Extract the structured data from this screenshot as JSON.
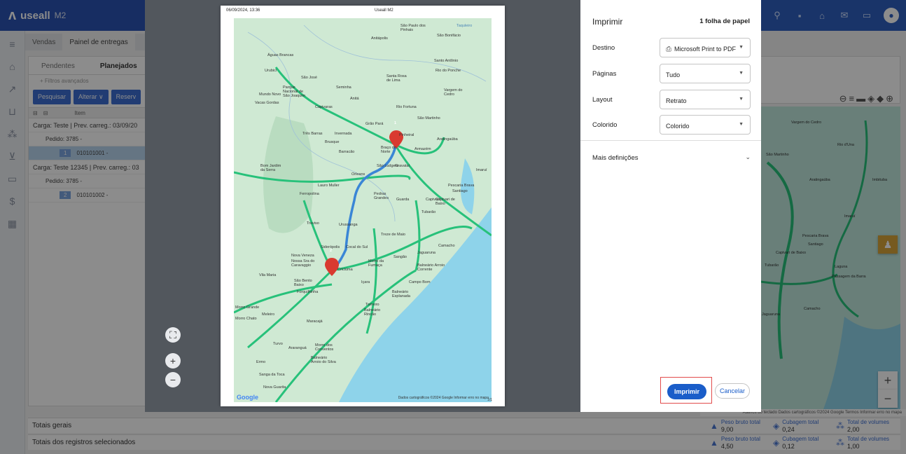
{
  "app": {
    "logo": "useall",
    "logo_sub": "M2",
    "tabs": [
      "Vendas",
      "Painel de entregas"
    ],
    "sub_tabs": [
      "Pendentes",
      "Planejados"
    ],
    "advanced_filters": "+ Filtros avançados",
    "toolbar": [
      "Pesquisar",
      "Alterar ∨",
      "Reserv"
    ],
    "grid_header_item": "Item",
    "rows": [
      "Carga: Teste | Prev. carreg.: 03/09/20",
      "Pedido: 3785 -",
      "010101001 -",
      "Carga: Teste 12345 | Prev. carreg.: 03",
      "Pedido: 3785 -",
      "010101002 -"
    ],
    "row_numbers": [
      "1",
      "2"
    ],
    "totals": {
      "geral_label": "Totais gerais",
      "selected_label": "Totais dos registros selecionados",
      "peso_label": "Peso bruto total",
      "cubagem_label": "Cubagem total",
      "volumes_label": "Total de volumes",
      "geral": {
        "peso": "9,00",
        "cubagem": "0,24",
        "volumes": "2,00"
      },
      "selected": {
        "peso": "4,50",
        "cubagem": "0,12",
        "volumes": "1,00"
      }
    },
    "right_map_labels": [
      "Vargem do Cedro",
      "Rio d'Una",
      "São Martinho",
      "Aratingaúba",
      "Imbituba",
      "Imaruí",
      "Pescaria Brava",
      "Santiago",
      "Capivari de Baixo",
      "Tubarão",
      "Laguna",
      "Passagem da Barra",
      "Camacho",
      "Jaguaruna"
    ],
    "map_credit": "Atalhos do teclado  Dados cartográficos ©2024 Google  Termos  Informar erro no mapa"
  },
  "preview": {
    "date": "06/09/2024, 13:36",
    "title": "Useall M2",
    "page_number": "1/1",
    "footer_credit": "Dados cartográficos ©2024 Google  Informar erro no mapa",
    "google": "Google",
    "markers": [
      "1",
      "2"
    ],
    "map_labels": [
      "Águas Brancas",
      "Urubici",
      "São José",
      "Parque Nacional de São Joaquim",
      "Mundo Novo",
      "Vacas Gordas",
      "Seminha",
      "Anitá",
      "Capivaras",
      "Rio Fortuna",
      "Santa Rosa de Lima",
      "Vargem do Cedro",
      "São Martinho",
      "Grão Pará",
      "Três Barras",
      "Invernada",
      "Pinheiral",
      "Aratingaúba",
      "Brusque",
      "Barracão",
      "Braço do Norte",
      "Armazém",
      "São Ludgero",
      "Gravatal",
      "Imaruí",
      "Bom Jardim da Serra",
      "Orleans",
      "Lauro Muller",
      "Pescaria Brava",
      "Santiago",
      "Ferropolina",
      "Pedras Grandes",
      "Guarda",
      "Capivari de Baixo",
      "Tubarão",
      "Treviso",
      "Urussanga",
      "Treze de Maio",
      "Siderópolis",
      "Cocal do Sul",
      "Jaguaruna",
      "Nova Veneza",
      "Nossa Sra do Caravaggio",
      "Morro da Fumaça",
      "Sangão",
      "Criciúma",
      "Vila Maria",
      "São Bento Baixo",
      "Içara",
      "Balneário Arroio Corrente",
      "Campo Bom",
      "Forquilhinha",
      "Balneário Esplanada",
      "Tomeiro",
      "Balneário Rincão",
      "Meleiro",
      "Maracajá",
      "Morro Chato",
      "Morro Grande",
      "Turvo",
      "Araranguá",
      "Morro dos Conventos",
      "Ermo",
      "Balneário Arroio do Silva",
      "Sanga da Toca",
      "Nova Guarita",
      "São Paulo dos Pinhais",
      "São Bonifácio",
      "Anitápolis",
      "Santo Antônio",
      "Rio do Ponche",
      "Taquleiro",
      "Capivari",
      "Camacho"
    ]
  },
  "dialog": {
    "title": "Imprimir",
    "sheets": "1 folha de papel",
    "destino_label": "Destino",
    "destino_value": "Microsoft Print to PDF",
    "paginas_label": "Páginas",
    "paginas_value": "Tudo",
    "layout_label": "Layout",
    "layout_value": "Retrato",
    "colorido_label": "Colorido",
    "colorido_value": "Colorido",
    "more_settings": "Mais definições",
    "print_button": "Imprimir",
    "cancel_button": "Cancelar"
  },
  "colors": {
    "header_blue": "#2f5fc0",
    "print_blue": "#1a5dc9",
    "highlight_red": "#e24b4b",
    "road_green": "#27c17a",
    "route_blue": "#3a86d6",
    "marker_red": "#d93a30",
    "sea": "#8ed3ea"
  }
}
